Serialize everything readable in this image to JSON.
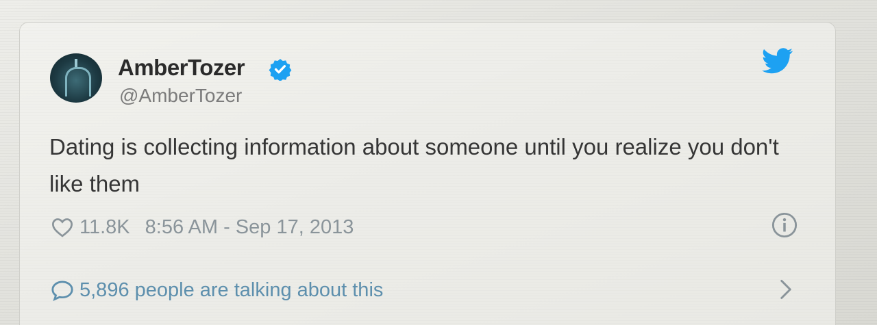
{
  "tweet": {
    "author": {
      "display_name": "AmberTozer",
      "handle": "@AmberTozer",
      "verified": true,
      "avatar_icon": "church-photo-avatar"
    },
    "text": "Dating is collecting information about someone until you realize you don't like them",
    "likes": "11.8K",
    "timestamp": "8:56 AM - Sep 17, 2013",
    "conversation_text": "5,896 people are talking about this",
    "icons": {
      "brand": "twitter-bird-icon",
      "verified": "verified-badge-icon",
      "like": "heart-icon",
      "info": "info-icon",
      "conversation": "speech-bubble-icon",
      "chevron": "chevron-right-icon"
    },
    "colors": {
      "twitter_blue": "#1da1f2",
      "name_text": "#2a2a2a",
      "handle_text": "#7b7b7b",
      "meta_text": "#8a949a",
      "link_text": "#5d8fad"
    }
  }
}
